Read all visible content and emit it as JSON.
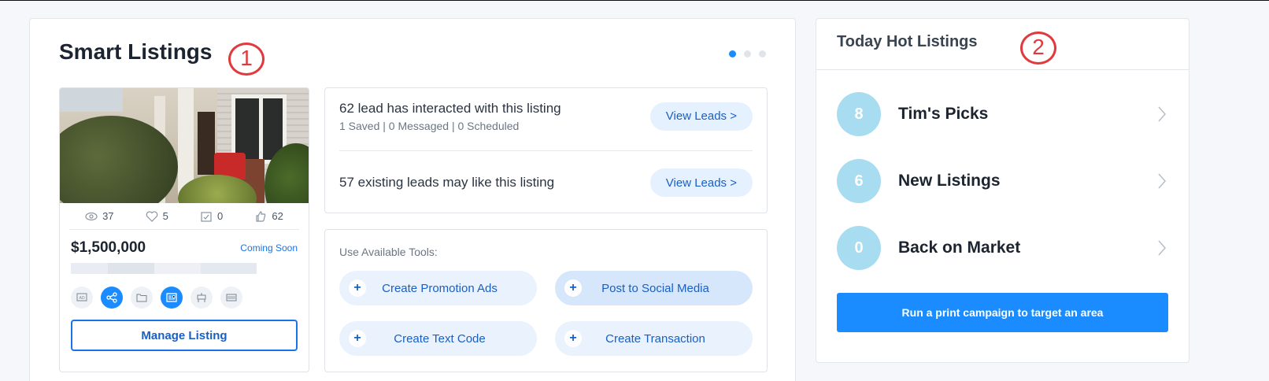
{
  "smart_listings": {
    "title": "Smart Listings",
    "annotation": "1",
    "carousel_dots": 3,
    "listing": {
      "stats": {
        "views": "37",
        "favorites": "5",
        "saved": "0",
        "shares": "62"
      },
      "price": "$1,500,000",
      "status": "Coming Soon",
      "manage_label": "Manage Listing"
    },
    "leads": [
      {
        "main": "62 lead has interacted with this listing",
        "sub": "1 Saved | 0 Messaged | 0 Scheduled",
        "button": "View Leads >"
      },
      {
        "main": "57 existing leads may like this listing",
        "sub": "",
        "button": "View Leads >"
      }
    ],
    "tools": {
      "label": "Use Available Tools:",
      "items": [
        {
          "label": "Create Promotion Ads"
        },
        {
          "label": "Post to Social Media"
        },
        {
          "label": "Create Text Code"
        },
        {
          "label": "Create Transaction"
        }
      ]
    },
    "colors": {
      "accent": "#1a8cff",
      "annotation": "#e0393e"
    }
  },
  "hot_listings": {
    "title": "Today Hot Listings",
    "annotation": "2",
    "items": [
      {
        "count": "8",
        "name": "Tim's Picks"
      },
      {
        "count": "6",
        "name": "New Listings"
      },
      {
        "count": "0",
        "name": "Back on Market"
      }
    ],
    "campaign_label": "Run a print campaign to target an area"
  }
}
